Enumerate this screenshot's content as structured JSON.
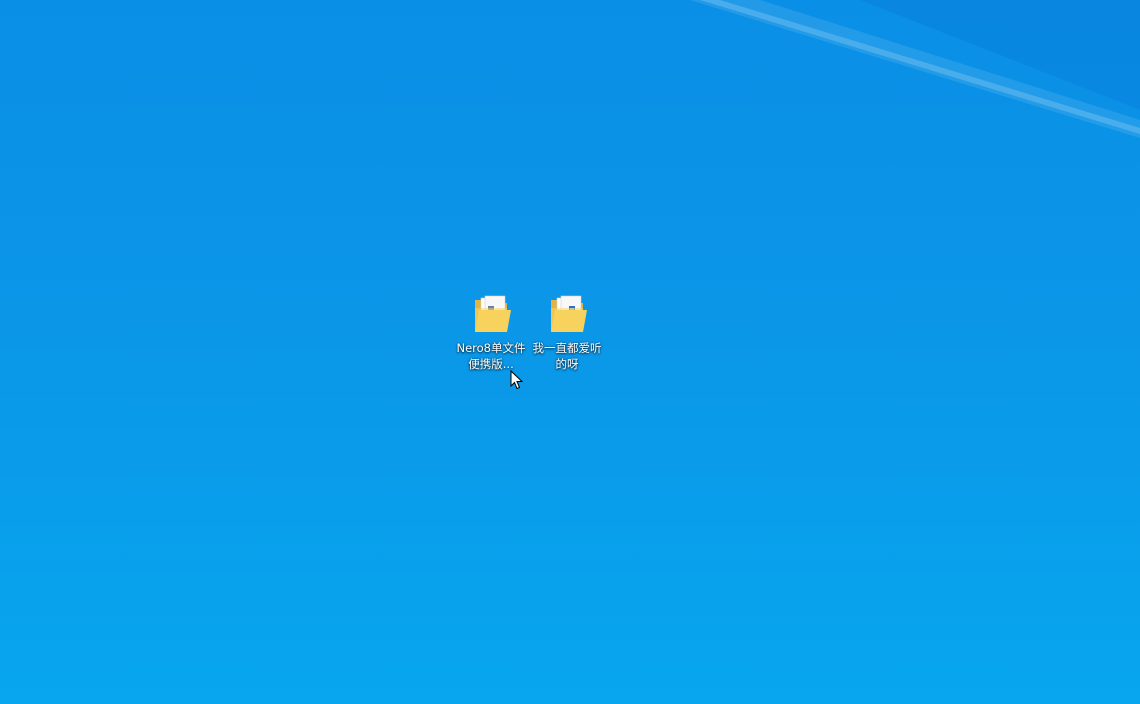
{
  "desktop": {
    "background_color": "#0b96e8",
    "icons": [
      {
        "label": "Nero8单文件便携版...",
        "icon": "folder-icon",
        "badge": "document-icon"
      },
      {
        "label": "我一直都爱听的呀",
        "icon": "folder-icon",
        "badge": "media-file-icon"
      }
    ]
  }
}
